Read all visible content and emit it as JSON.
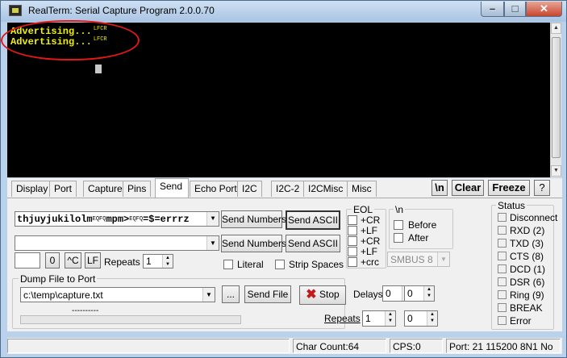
{
  "window": {
    "title": "RealTerm: Serial Capture Program 2.0.0.70",
    "min_glyph": "–",
    "max_glyph": "□",
    "close_glyph": "✕"
  },
  "terminal": {
    "lines": [
      "Advertising...",
      "Advertising..."
    ],
    "line_end": "LFCR"
  },
  "tabs": [
    "Display",
    "Port",
    "Capture",
    "Pins",
    "Send",
    "Echo Port",
    "I2C",
    "I2C-2",
    "I2CMisc",
    "Misc"
  ],
  "selected_tab": "Send",
  "toolbar": {
    "newline_label": "\\n",
    "clear_label": "Clear",
    "freeze_label": "Freeze",
    "help_label": "?"
  },
  "send": {
    "line1_parts": [
      "thjuyjukilolm",
      "EQFQ",
      "mpm>",
      "EQFQ",
      "=$=errrz"
    ],
    "line2_value": "",
    "send_numbers_label": "Send Numbers",
    "send_ascii_label": "Send ASCII",
    "small_value": "",
    "zero_label": "0",
    "ctrl_c_label": "^C",
    "lf_label": "LF",
    "repeats_label": "Repeats",
    "repeats_value": "1",
    "literal_label": "Literal",
    "strip_spaces_label": "Strip Spaces"
  },
  "eol": {
    "title": "EOL",
    "items": [
      "+CR",
      "+LF",
      "+CR",
      "+LF",
      "+crc"
    ]
  },
  "newline_group": {
    "title": "\\n",
    "before_label": "Before",
    "after_label": "After",
    "smbus_value": "SMBUS 8"
  },
  "dump": {
    "title": "Dump File to Port",
    "file_value": "c:\\temp\\capture.txt",
    "browse_label": "...",
    "send_file_label": "Send File",
    "stop_label": "Stop",
    "delays_label": "Delays",
    "delay1": "0",
    "delay2": "0",
    "repeats_label": "Repeats",
    "repeats1": "1",
    "repeats2": "0",
    "dashes": "----------"
  },
  "status": {
    "title": "Status",
    "items": [
      "Disconnect",
      "RXD (2)",
      "TXD (3)",
      "CTS (8)",
      "DCD (1)",
      "DSR (6)",
      "Ring (9)",
      "BREAK",
      "Error"
    ]
  },
  "statusbar": {
    "char_count": "Char Count:64",
    "cps": "CPS:0",
    "port": "Port: 21 115200 8N1 No"
  }
}
